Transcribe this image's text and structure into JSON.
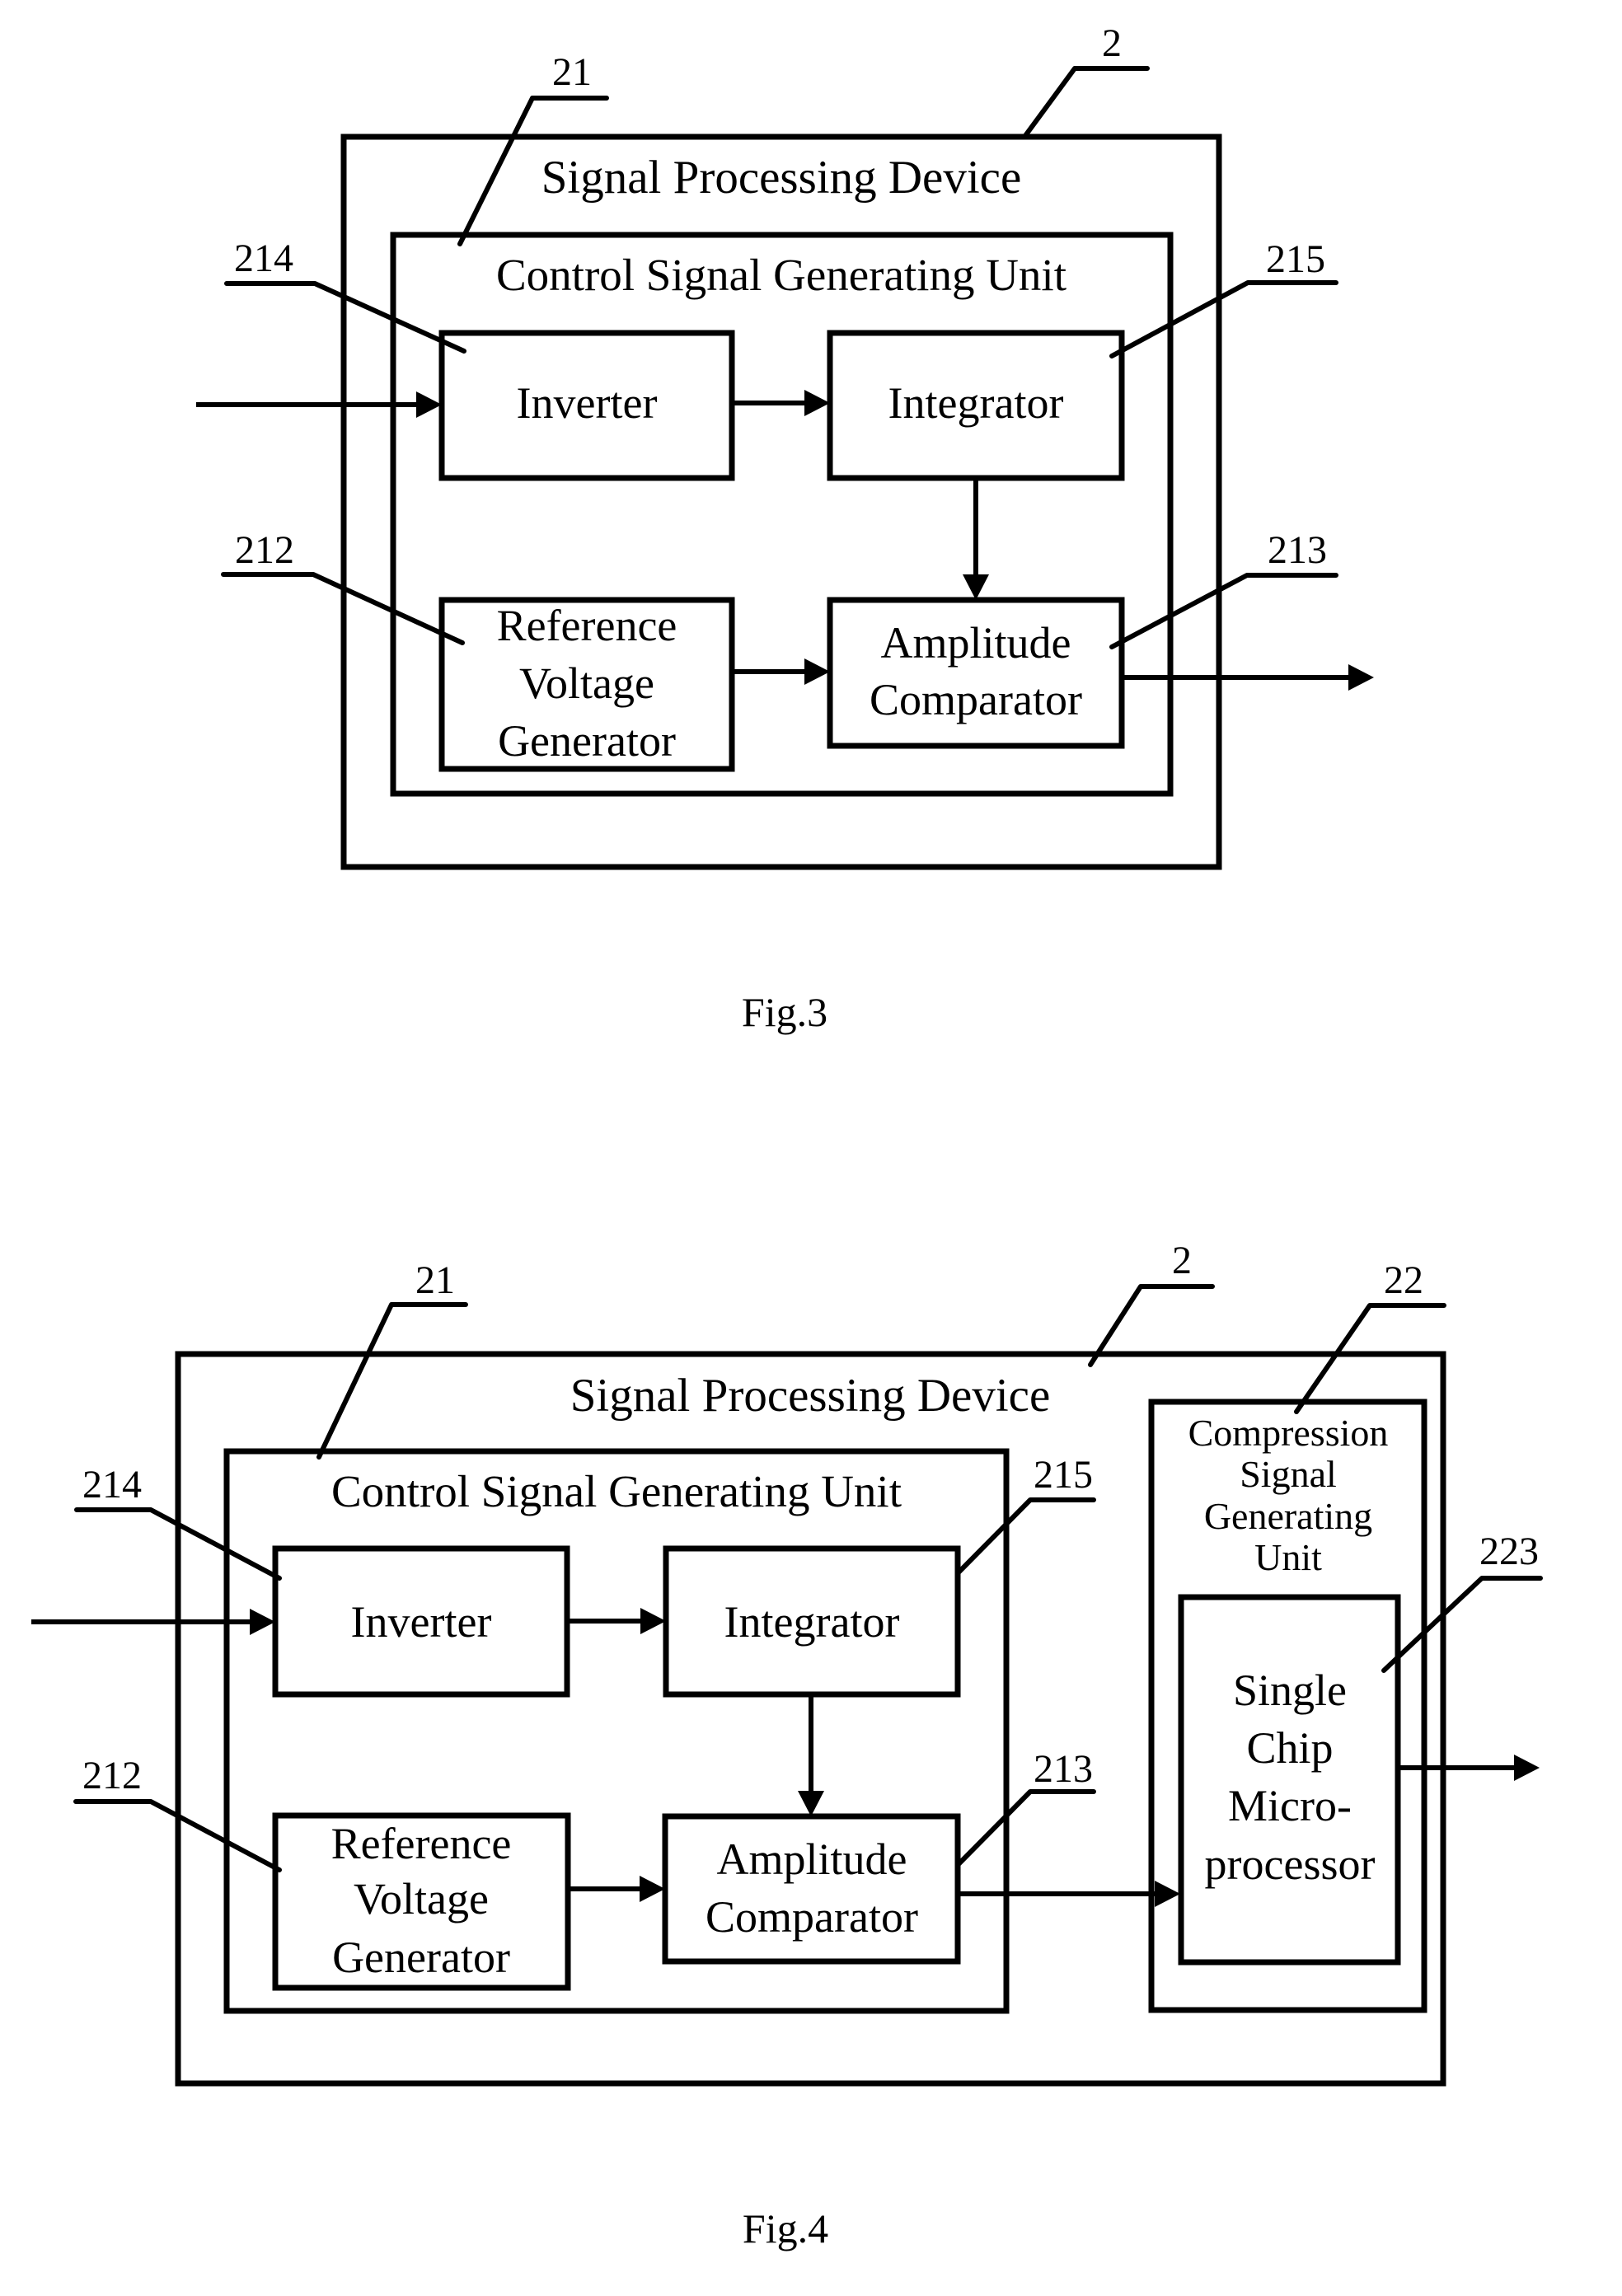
{
  "colors": {
    "ink": "#000000",
    "paper": "#ffffff"
  },
  "figures": [
    {
      "id": "fig3",
      "caption": "Fig.3",
      "device": {
        "ref": "2",
        "title": "Signal Processing Device"
      },
      "unit": {
        "ref": "21",
        "title": "Control Signal Generating Unit"
      },
      "blocks": [
        {
          "id": "inverter",
          "ref": "214",
          "lines": [
            "Inverter"
          ]
        },
        {
          "id": "integrator",
          "ref": "215",
          "lines": [
            "Integrator"
          ]
        },
        {
          "id": "reference-voltage-generator",
          "ref": "212",
          "lines": [
            "Reference",
            "Voltage",
            "Generator"
          ]
        },
        {
          "id": "amplitude-comparator",
          "ref": "213",
          "lines": [
            "Amplitude",
            "Comparator"
          ]
        }
      ],
      "connections": [
        {
          "from": "input",
          "to": "inverter"
        },
        {
          "from": "inverter",
          "to": "integrator"
        },
        {
          "from": "integrator",
          "to": "amplitude-comparator"
        },
        {
          "from": "reference-voltage-generator",
          "to": "amplitude-comparator"
        },
        {
          "from": "amplitude-comparator",
          "to": "output"
        }
      ]
    },
    {
      "id": "fig4",
      "caption": "Fig.4",
      "device": {
        "ref": "2",
        "title": "Signal Processing Device"
      },
      "unit": {
        "ref": "21",
        "title": "Control Signal Generating Unit"
      },
      "compression_unit": {
        "ref": "22",
        "lines": [
          "Compression",
          "Signal",
          "Generating",
          "Unit"
        ]
      },
      "blocks": [
        {
          "id": "inverter",
          "ref": "214",
          "lines": [
            "Inverter"
          ]
        },
        {
          "id": "integrator",
          "ref": "215",
          "lines": [
            "Integrator"
          ]
        },
        {
          "id": "reference-voltage-generator",
          "ref": "212",
          "lines": [
            "Reference",
            "Voltage",
            "Generator"
          ]
        },
        {
          "id": "amplitude-comparator",
          "ref": "213",
          "lines": [
            "Amplitude",
            "Comparator"
          ]
        },
        {
          "id": "single-chip-microprocessor",
          "ref": "223",
          "lines": [
            "Single",
            "Chip",
            "Micro-",
            "processor"
          ]
        }
      ],
      "connections": [
        {
          "from": "input",
          "to": "inverter"
        },
        {
          "from": "inverter",
          "to": "integrator"
        },
        {
          "from": "integrator",
          "to": "amplitude-comparator"
        },
        {
          "from": "reference-voltage-generator",
          "to": "amplitude-comparator"
        },
        {
          "from": "amplitude-comparator",
          "to": "single-chip-microprocessor"
        },
        {
          "from": "single-chip-microprocessor",
          "to": "output"
        }
      ]
    }
  ]
}
